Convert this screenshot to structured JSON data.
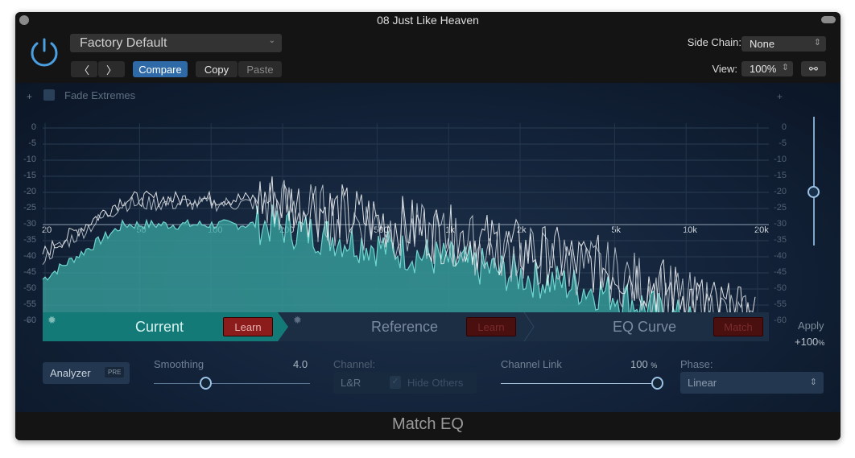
{
  "window": {
    "title": "08 Just Like Heaven",
    "footer": "Match EQ"
  },
  "header": {
    "preset": "Factory Default",
    "compare": "Compare",
    "copy": "Copy",
    "paste": "Paste",
    "side_chain_label": "Side Chain:",
    "side_chain_value": "None",
    "view_label": "View:",
    "view_value": "100%"
  },
  "graph": {
    "fade_extremes": "Fade Extremes",
    "plus": "+",
    "minus": "-",
    "db_labels": [
      "0",
      "-5",
      "-10",
      "-15",
      "-20",
      "-25",
      "-30",
      "-35",
      "-40",
      "-45",
      "-50",
      "-55",
      "-60"
    ],
    "freq_labels": [
      "20",
      "50",
      "100",
      "200",
      "500",
      "1k",
      "2k",
      "5k",
      "10k",
      "20k"
    ],
    "freq_values": [
      20,
      50,
      100,
      200,
      500,
      1000,
      2000,
      5000,
      10000,
      20000
    ]
  },
  "apply": {
    "label": "Apply",
    "value": "+100",
    "unit": "%",
    "slider_db": -20
  },
  "tabs": {
    "current": "Current",
    "current_learn": "Learn",
    "reference": "Reference",
    "reference_learn": "Learn",
    "eq_curve": "EQ Curve",
    "match": "Match"
  },
  "controls": {
    "analyzer": "Analyzer",
    "pre": "PRE",
    "smoothing_label": "Smoothing",
    "smoothing_value": "4.0",
    "smoothing_fraction": 0.33,
    "channel_label": "Channel:",
    "channel_value": "L&R",
    "hide_others": "Hide Others",
    "channel_link_label": "Channel Link",
    "channel_link_value": "100",
    "channel_link_unit": "%",
    "channel_link_fraction": 1.0,
    "phase_label": "Phase:",
    "phase_value": "Linear"
  },
  "colors": {
    "accent": "#2f6aa8",
    "teal": "#147a78",
    "fill": "#3aa7a2",
    "learn": "#8c1c1c"
  }
}
